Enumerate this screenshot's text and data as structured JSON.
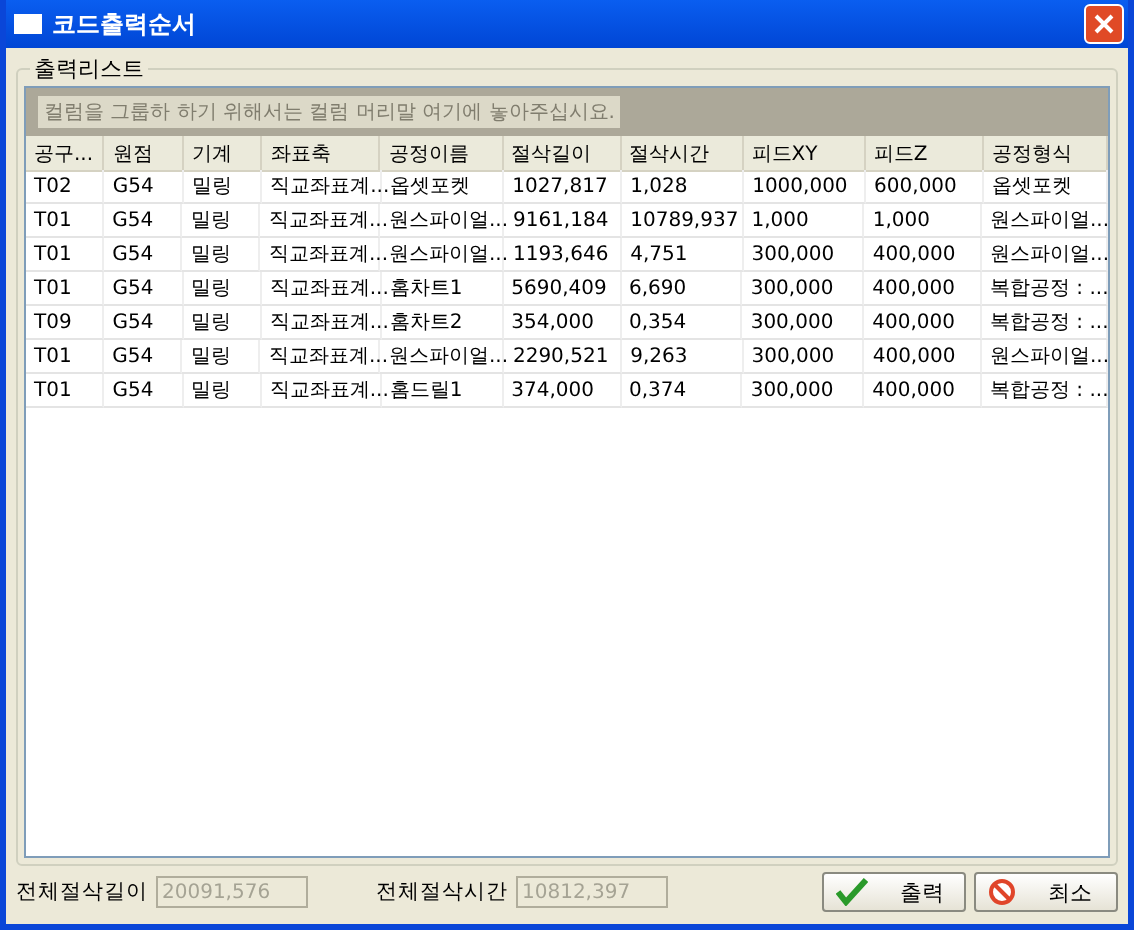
{
  "window": {
    "title": "코드출력순서"
  },
  "group": {
    "label": "출력리스트",
    "group_hint": "컬럼을 그룹하 하기 위해서는 컬럼 머리말 여기에 놓아주십시요."
  },
  "table": {
    "columns": [
      "공구...",
      "원점",
      "기계",
      "좌표축",
      "공정이름",
      "절삭길이",
      "절삭시간",
      "피드XY",
      "피드Z",
      "공정형식"
    ],
    "rows": [
      [
        "T02",
        "G54",
        "밀링",
        "직교좌표계...",
        "옵셋포켓",
        "1027,817",
        "1,028",
        "1000,000",
        "600,000",
        "옵셋포켓"
      ],
      [
        "T01",
        "G54",
        "밀링",
        "직교좌표계...",
        "원스파이얼...",
        "9161,184",
        "10789,937",
        "1,000",
        "1,000",
        "원스파이얼..."
      ],
      [
        "T01",
        "G54",
        "밀링",
        "직교좌표계...",
        "원스파이얼...",
        "1193,646",
        "4,751",
        "300,000",
        "400,000",
        "원스파이얼..."
      ],
      [
        "T01",
        "G54",
        "밀링",
        "직교좌표계...",
        "홈차트1",
        "5690,409",
        "6,690",
        "300,000",
        "400,000",
        "복합공정 : ..."
      ],
      [
        "T09",
        "G54",
        "밀링",
        "직교좌표계...",
        "홈차트2",
        "354,000",
        "0,354",
        "300,000",
        "400,000",
        "복합공정 : ..."
      ],
      [
        "T01",
        "G54",
        "밀링",
        "직교좌표계...",
        "원스파이얼...",
        "2290,521",
        "9,263",
        "300,000",
        "400,000",
        "원스파이얼..."
      ],
      [
        "T01",
        "G54",
        "밀링",
        "직교좌표계...",
        "홈드릴1",
        "374,000",
        "0,374",
        "300,000",
        "400,000",
        "복합공정 : ..."
      ]
    ]
  },
  "totals": [
    {
      "label": "전체절삭길이",
      "value": "20091,576"
    },
    {
      "label": "전체절삭시간",
      "value": "10812,397"
    }
  ],
  "buttons": [
    {
      "kind": "ok",
      "label": "출력"
    },
    {
      "kind": "cancel",
      "label": "최소"
    }
  ]
}
